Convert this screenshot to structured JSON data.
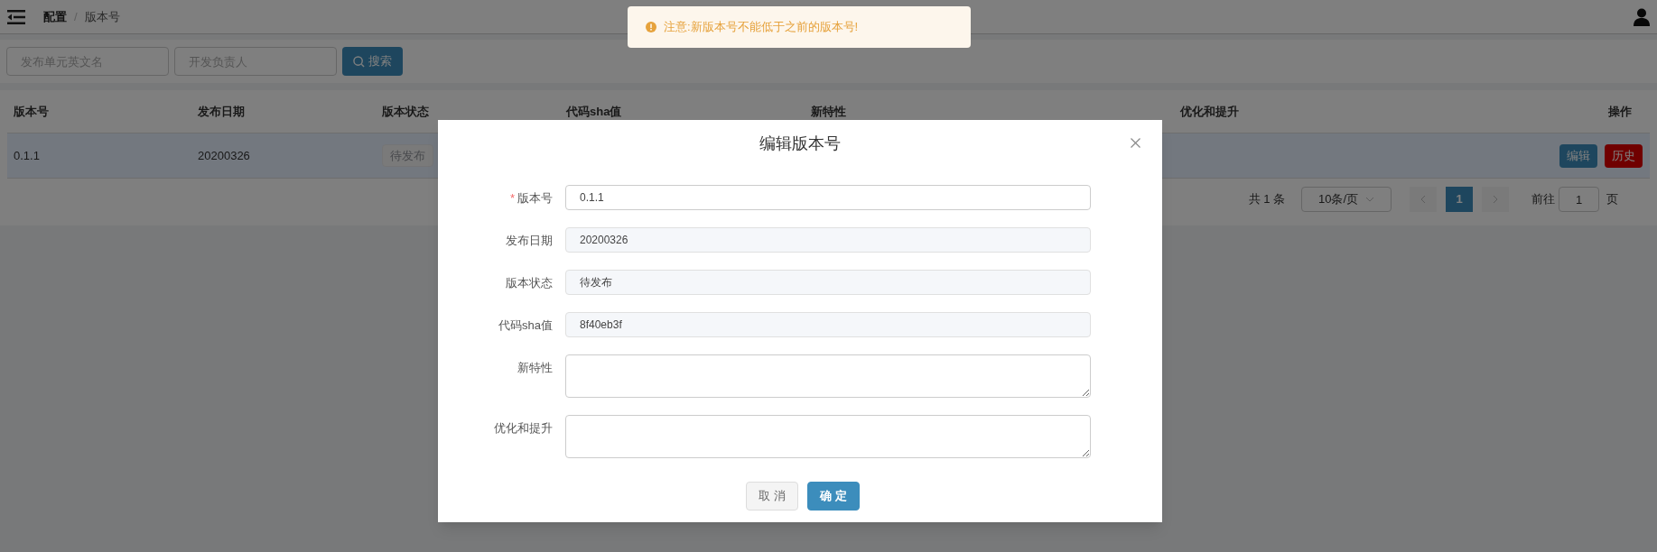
{
  "breadcrumb": {
    "items": [
      "配置",
      "版本号"
    ],
    "separator": "/"
  },
  "toast": {
    "message": "注意:新版本号不能低于之前的版本号!"
  },
  "search": {
    "fields": [
      {
        "placeholder": "发布单元英文名"
      },
      {
        "placeholder": "开发负责人"
      }
    ],
    "button": "搜索"
  },
  "table": {
    "columns": [
      "版本号",
      "发布日期",
      "版本状态",
      "代码sha值",
      "新特性",
      "优化和提升",
      "操作"
    ],
    "rows": [
      {
        "selected": true,
        "version": "0.1.1",
        "date": "20200326",
        "status": "待发布",
        "actions": [
          {
            "label": "编辑",
            "kind": "edit"
          },
          {
            "label": "历史",
            "kind": "history"
          }
        ]
      }
    ]
  },
  "pagination": {
    "total": "共 1 条",
    "page_size": "10条/页",
    "pages": [
      {
        "label": "1",
        "selected": true
      }
    ],
    "goto_label": "前往",
    "goto_value": "1",
    "goto_suffix": "页"
  },
  "dialog": {
    "title": "编辑版本号",
    "fields": [
      {
        "label": "版本号",
        "kind": "input",
        "required_mark": "*",
        "disabled": false,
        "value": "0.1.1"
      },
      {
        "label": "发布日期",
        "kind": "input",
        "disabled": true,
        "value": "20200326"
      },
      {
        "label": "版本状态",
        "kind": "input",
        "disabled": true,
        "value": "待发布"
      },
      {
        "label": "代码sha值",
        "kind": "input",
        "disabled": true,
        "value": "8f40eb3f"
      },
      {
        "label": "新特性",
        "kind": "textarea"
      },
      {
        "label": "优化和提升",
        "kind": "textarea"
      }
    ],
    "buttons": [
      {
        "label": "取 消",
        "kind": "cancel"
      },
      {
        "label": "确 定",
        "kind": "primary"
      }
    ]
  }
}
